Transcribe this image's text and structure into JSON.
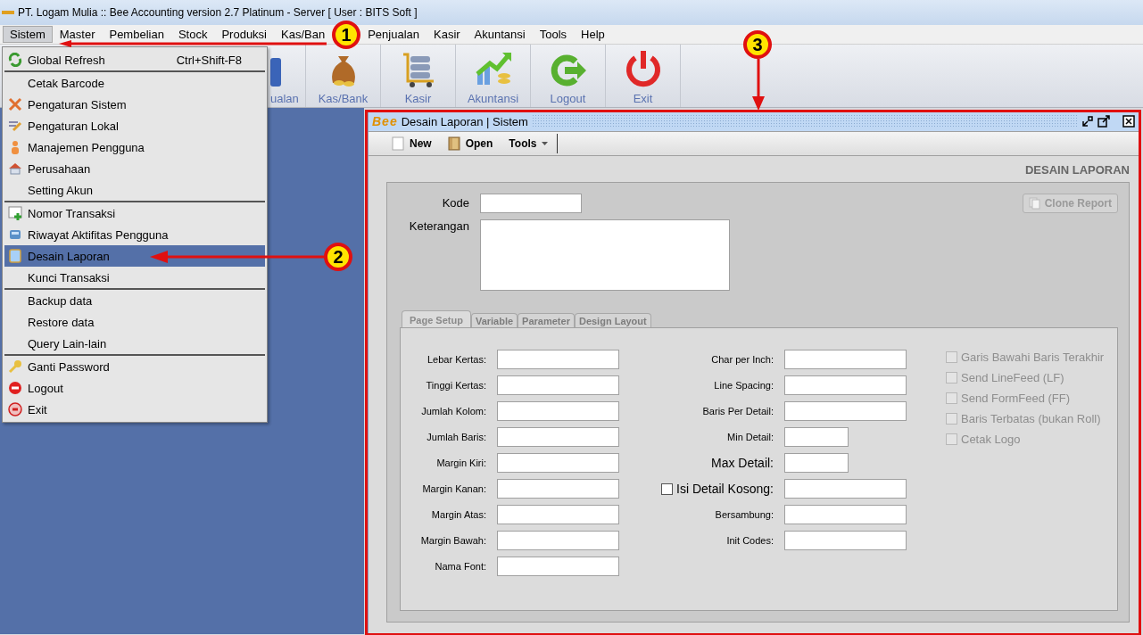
{
  "window": {
    "title": "PT. Logam Mulia :: Bee Accounting version 2.7 Platinum - Server  [ User : BITS Soft ]"
  },
  "menu_bar": [
    {
      "label": "Sistem",
      "selected": true
    },
    {
      "label": "Master",
      "selected": false
    },
    {
      "label": "Pembelian",
      "selected": false
    },
    {
      "label": "Stock",
      "selected": false
    },
    {
      "label": "Produksi",
      "selected": false
    },
    {
      "label": "Kas/Ban",
      "selected": false
    },
    {
      "label": "Penjualan",
      "selected": false
    },
    {
      "label": "Kasir",
      "selected": false
    },
    {
      "label": "Akuntansi",
      "selected": false
    },
    {
      "label": "Tools",
      "selected": false
    },
    {
      "label": "Help",
      "selected": false
    }
  ],
  "toolbar": [
    {
      "label": "ualan",
      "kind": "bag"
    },
    {
      "label": "Kas/Bank",
      "kind": "moneybag"
    },
    {
      "label": "Kasir",
      "kind": "cart"
    },
    {
      "label": "Akuntansi",
      "kind": "chart"
    },
    {
      "label": "Logout",
      "kind": "logout"
    },
    {
      "label": "Exit",
      "kind": "power"
    }
  ],
  "sistem_menu": [
    {
      "label": "Global Refresh",
      "shortcut": "Ctrl+Shift-F8",
      "kind": "refresh",
      "selected": false,
      "separator_after": true
    },
    {
      "label": "Cetak Barcode",
      "kind": "none",
      "selected": false,
      "separator_after": false
    },
    {
      "label": "Pengaturan Sistem",
      "kind": "tools",
      "selected": false,
      "separator_after": false
    },
    {
      "label": "Pengaturan Lokal",
      "kind": "edit",
      "selected": false,
      "separator_after": false
    },
    {
      "label": "Manajemen Pengguna",
      "kind": "user",
      "selected": false,
      "separator_after": false
    },
    {
      "label": "Perusahaan",
      "kind": "house",
      "selected": false,
      "separator_after": false
    },
    {
      "label": "Setting Akun",
      "kind": "none",
      "selected": false,
      "separator_after": true
    },
    {
      "label": "Nomor Transaksi",
      "kind": "add",
      "selected": false,
      "separator_after": false
    },
    {
      "label": "Riwayat Aktifitas Pengguna",
      "kind": "history",
      "selected": false,
      "separator_after": false
    },
    {
      "label": "Desain Laporan",
      "kind": "report",
      "selected": true,
      "separator_after": false
    },
    {
      "label": "Kunci Transaksi",
      "kind": "none",
      "selected": false,
      "separator_after": true
    },
    {
      "label": "Backup data",
      "kind": "none",
      "selected": false,
      "separator_after": false
    },
    {
      "label": "Restore data",
      "kind": "none",
      "selected": false,
      "separator_after": false
    },
    {
      "label": "Query Lain-lain",
      "kind": "none",
      "selected": false,
      "separator_after": true
    },
    {
      "label": "Ganti Password",
      "kind": "key",
      "selected": false,
      "separator_after": false
    },
    {
      "label": "Logout",
      "kind": "logout",
      "selected": false,
      "separator_after": false
    },
    {
      "label": "Exit",
      "kind": "exit",
      "selected": false,
      "separator_after": false
    }
  ],
  "internal_window": {
    "logo": "Bee",
    "title": "Desain Laporan | Sistem",
    "toolbar": [
      {
        "label": "New",
        "kind": "new"
      },
      {
        "label": "Open",
        "kind": "open"
      },
      {
        "label": "Tools",
        "kind": "tools"
      }
    ],
    "heading": "DESAIN LAPORAN",
    "kode": {
      "label": "Kode"
    },
    "keterangan": {
      "label": "Keterangan"
    },
    "clone_button": {
      "label": "Clone Report",
      "disabled": true
    },
    "tabs": [
      {
        "label": "Page Setup",
        "selected": true
      },
      {
        "label": "Variable",
        "selected": false
      },
      {
        "label": "Parameter",
        "selected": false
      },
      {
        "label": "Design Layout",
        "selected": false
      }
    ],
    "left_fields": [
      {
        "label": "Lebar Kertas:"
      },
      {
        "label": "Tinggi Kertas:"
      },
      {
        "label": "Jumlah Kolom:"
      },
      {
        "label": "Jumlah Baris:"
      },
      {
        "label": "Margin Kiri:"
      },
      {
        "label": "Margin Kanan:"
      },
      {
        "label": "Margin Atas:"
      },
      {
        "label": "Margin Bawah:"
      },
      {
        "label": "Nama Font:"
      }
    ],
    "middle_fields": [
      {
        "label": "Char per Inch:",
        "kind": "wide"
      },
      {
        "label": "Line Spacing:",
        "kind": "wide"
      },
      {
        "label": "Baris Per Detail:",
        "kind": "wide"
      },
      {
        "label": "Min Detail:",
        "kind": "narrow"
      },
      {
        "label": "Max Detail:",
        "kind": "narrow-large"
      },
      {
        "label": "Isi Detail Kosong:",
        "kind": "checkbox",
        "checked": false
      },
      {
        "label": "Bersambung:",
        "kind": "wide"
      },
      {
        "label": "Init Codes:",
        "kind": "wide"
      }
    ],
    "options": [
      {
        "label": "Garis Bawahi Baris Terakhir",
        "checked": false,
        "disabled": true
      },
      {
        "label": "Send LineFeed (LF)",
        "checked": false,
        "disabled": true
      },
      {
        "label": "Send FormFeed (FF)",
        "checked": false,
        "disabled": true
      },
      {
        "label": "Baris Terbatas (bukan Roll)",
        "checked": false,
        "disabled": true
      },
      {
        "label": "Cetak Logo",
        "checked": false,
        "disabled": true
      }
    ]
  },
  "callouts": [
    {
      "number": "1"
    },
    {
      "number": "2"
    },
    {
      "number": "3"
    }
  ]
}
